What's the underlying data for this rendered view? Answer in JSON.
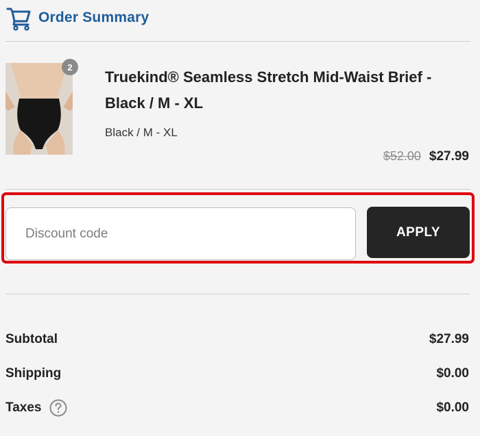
{
  "header": {
    "title": "Order Summary",
    "icon": "cart-icon",
    "accent_color": "#1f5d9a"
  },
  "product": {
    "name": "Truekind® Seamless Stretch Mid-Waist Brief - Black / M - XL",
    "variant": "Black / M - XL",
    "quantity": "2",
    "original_price": "$52.00",
    "sale_price": "$27.99",
    "image": "product-image"
  },
  "discount": {
    "placeholder": "Discount code",
    "value": "",
    "apply_label": "APPLY",
    "highlight_color": "#e0000f"
  },
  "totals": [
    {
      "label": "Subtotal",
      "value": "$27.99"
    },
    {
      "label": "Shipping",
      "value": "$0.00"
    },
    {
      "label": "Taxes",
      "value": "$0.00",
      "icon": "help-icon"
    }
  ]
}
